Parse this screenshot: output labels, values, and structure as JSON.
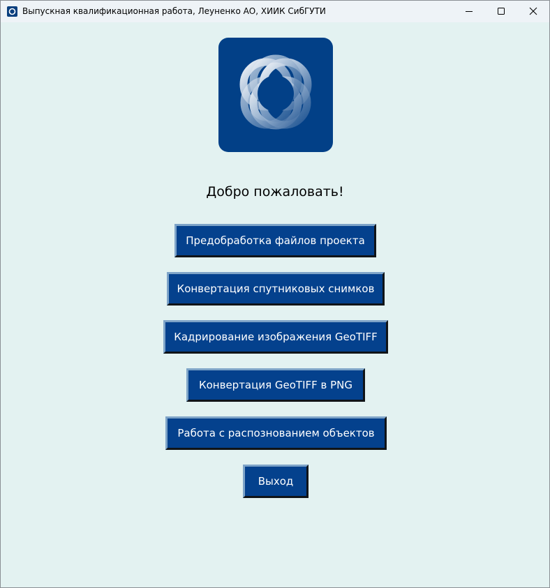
{
  "window": {
    "title": "Выпускная квалификационная работа, Леуненко АО, ХИИК СибГУТИ",
    "icon": "app-logo-icon",
    "controls": [
      "minimize-icon",
      "maximize-icon",
      "close-icon"
    ]
  },
  "main": {
    "logo": "rings-logo",
    "welcome": "Добро пожаловать!",
    "buttons": [
      {
        "label": "Предобработка файлов проекта"
      },
      {
        "label": "Конвертация спутниковых снимков"
      },
      {
        "label": "Кадрирование изображения GeoTIFF"
      },
      {
        "label": "Конвертация GeoTIFF в PNG"
      },
      {
        "label": "Работа с распознованием объектов"
      },
      {
        "label": "Выход"
      }
    ]
  },
  "colors": {
    "background": "#e3f2f1",
    "button": "#04418d",
    "button_text": "#ffffff",
    "logo_bg": "#024087"
  }
}
